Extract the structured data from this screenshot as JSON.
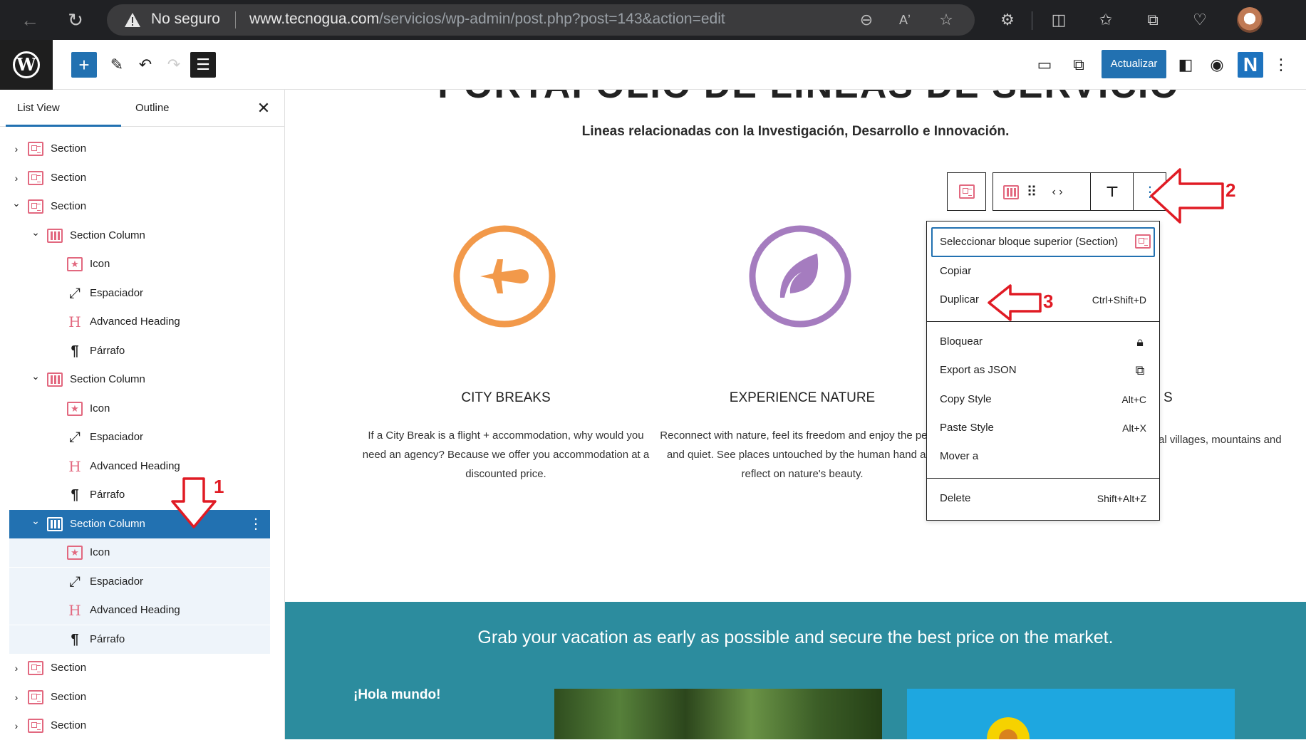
{
  "browser": {
    "address_status": "No seguro",
    "url_host": "www.tecnogua.com",
    "url_path": "/servicios/wp-admin/post.php?post=143&action=edit",
    "icons": [
      "back-icon",
      "refresh-icon",
      "warning-icon",
      "zoom-out-icon",
      "read-aloud-icon",
      "favorite-star-icon",
      "extensions-icon",
      "split-screen-icon",
      "favorites-icon",
      "collections-icon",
      "browser-essentials-icon",
      "profile-avatar"
    ]
  },
  "wp_header": {
    "update_label": "Actualizar",
    "n_logo": "N"
  },
  "left_panel": {
    "tabs": {
      "list_view": "List View",
      "outline": "Outline"
    },
    "tree": [
      {
        "label": "Section",
        "level": 0,
        "type": "section",
        "expanded": false
      },
      {
        "label": "Section",
        "level": 0,
        "type": "section",
        "expanded": false
      },
      {
        "label": "Section",
        "level": 0,
        "type": "section",
        "expanded": true
      },
      {
        "label": "Section Column",
        "level": 1,
        "type": "column",
        "expanded": true
      },
      {
        "label": "Icon",
        "level": 2,
        "type": "icon"
      },
      {
        "label": "Espaciador",
        "level": 2,
        "type": "spacer"
      },
      {
        "label": "Advanced Heading",
        "level": 2,
        "type": "heading"
      },
      {
        "label": "Párrafo",
        "level": 2,
        "type": "paragraph"
      },
      {
        "label": "Section Column",
        "level": 1,
        "type": "column",
        "expanded": true
      },
      {
        "label": "Icon",
        "level": 2,
        "type": "icon"
      },
      {
        "label": "Espaciador",
        "level": 2,
        "type": "spacer"
      },
      {
        "label": "Advanced Heading",
        "level": 2,
        "type": "heading"
      },
      {
        "label": "Párrafo",
        "level": 2,
        "type": "paragraph"
      },
      {
        "label": "Section Column",
        "level": 1,
        "type": "column",
        "expanded": true,
        "selected": true
      },
      {
        "label": "Icon",
        "level": 2,
        "type": "icon"
      },
      {
        "label": "Espaciador",
        "level": 2,
        "type": "spacer"
      },
      {
        "label": "Advanced Heading",
        "level": 2,
        "type": "heading"
      },
      {
        "label": "Párrafo",
        "level": 2,
        "type": "paragraph"
      },
      {
        "label": "Section",
        "level": 0,
        "type": "section",
        "expanded": false
      },
      {
        "label": "Section",
        "level": 0,
        "type": "section",
        "expanded": false
      },
      {
        "label": "Section",
        "level": 0,
        "type": "section",
        "expanded": false
      }
    ]
  },
  "canvas": {
    "section_title": "PORTAFOLIO DE LINEAS DE SERVICIO",
    "section_subtitle": "Lineas relacionadas con la Investigación, Desarrollo e Innovación.",
    "features": [
      {
        "heading": "CITY BREAKS",
        "text": "If a City Break is a flight + accommodation, why would you need an agency? Because we offer you accommodation at a discounted price.",
        "color": "#f2994a",
        "icon": "airplane-icon"
      },
      {
        "heading": "EXPERIENCE NATURE",
        "text": "Reconnect with nature, feel its freedom and enjoy the peace and quiet. See places untouched by the human hand and reflect on nature's beauty.",
        "color": "#a57cbf",
        "icon": "leaf-icon"
      },
      {
        "heading": "S",
        "text": "al villages, mountains and",
        "color": "#2c8c9e",
        "icon": "hidden-icon"
      }
    ],
    "band_title": "Grab your vacation as early as possible and secure the best price on the market.",
    "band_hello": "¡Hola mundo!",
    "band_color": "#2c8c9e"
  },
  "dropdown": {
    "select_parent": "Seleccionar bloque superior (Section)",
    "copy": "Copiar",
    "duplicate": "Duplicar",
    "duplicate_shortcut": "Ctrl+Shift+D",
    "lock": "Bloquear",
    "export_json": "Export as JSON",
    "copy_style": "Copy Style",
    "copy_style_shortcut": "Alt+C",
    "paste_style": "Paste Style",
    "paste_style_shortcut": "Alt+X",
    "move_to": "Mover a",
    "delete": "Delete",
    "delete_shortcut": "Shift+Alt+Z"
  },
  "annotations": {
    "one": "1",
    "two": "2",
    "three": "3",
    "color": "#e01b24"
  }
}
